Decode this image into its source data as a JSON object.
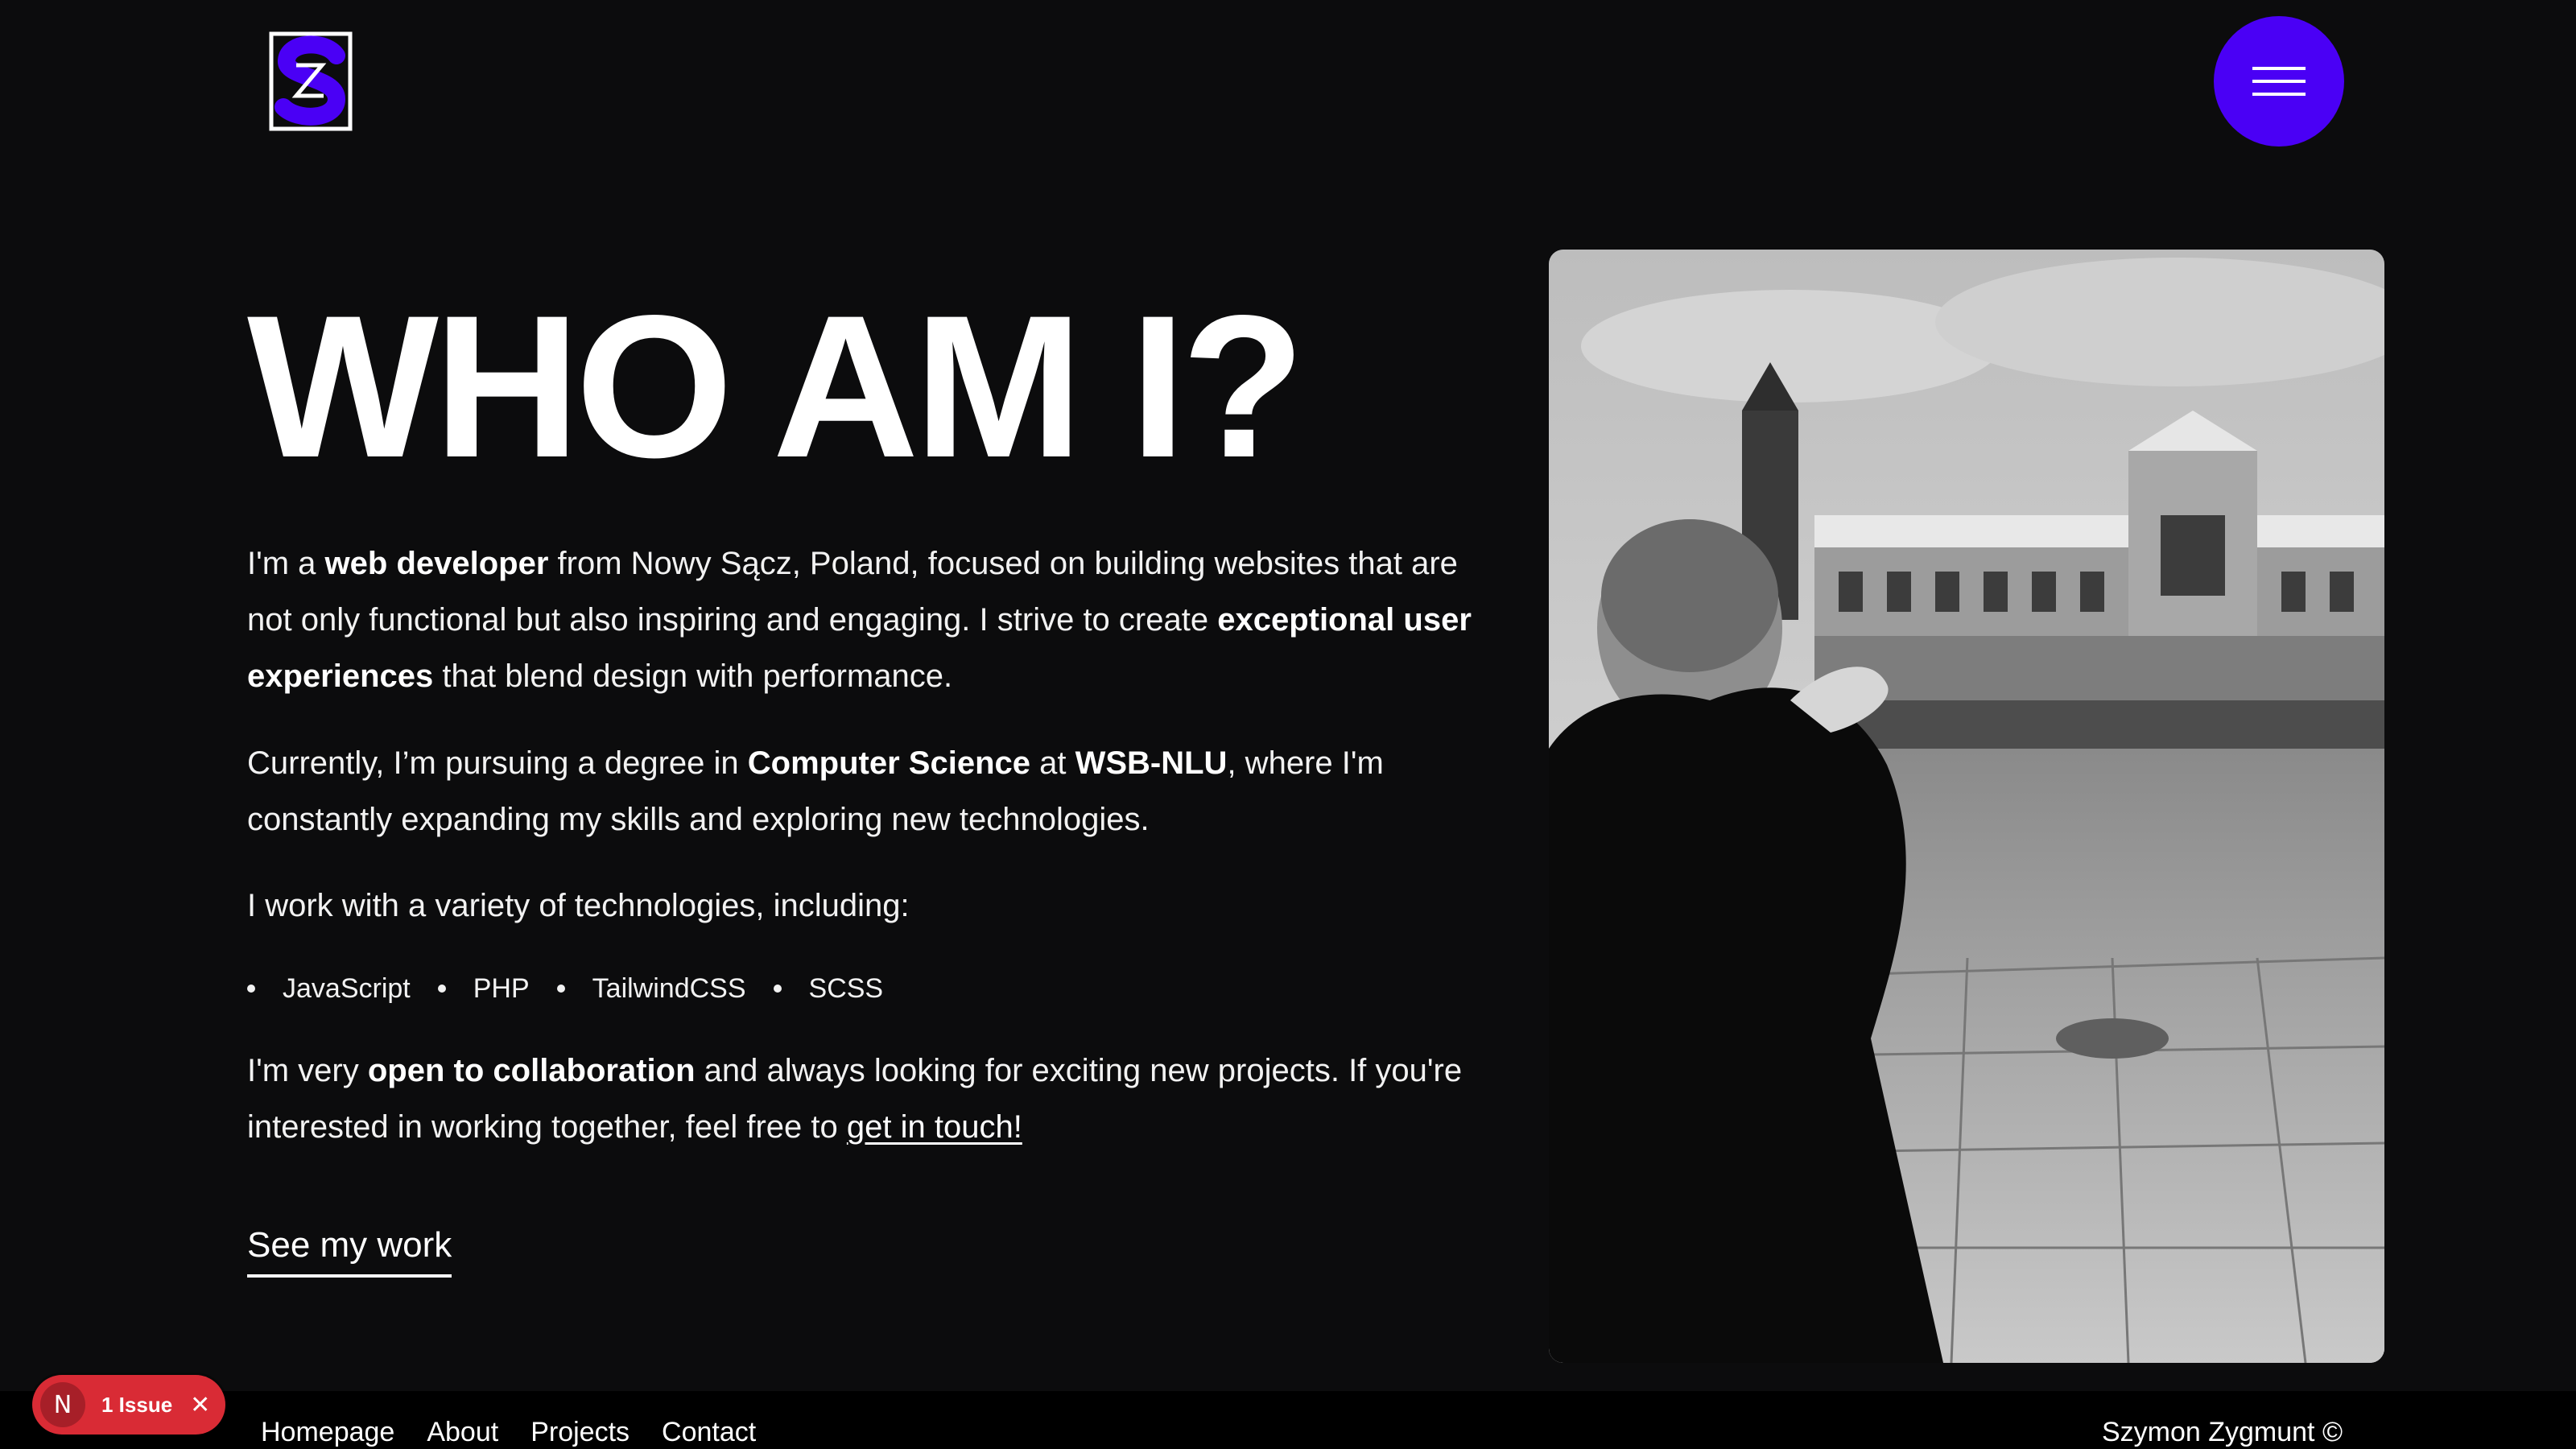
{
  "brand": {
    "logo_icon": "zs-monogram-logo",
    "accent_color": "#4a00f5"
  },
  "header": {
    "menu_icon": "hamburger-menu-icon"
  },
  "hero": {
    "title": "WHO AM I?",
    "intro": {
      "p1": "I'm a ",
      "b1": "web developer",
      "p2": " from Nowy Sącz, Poland, focused on building websites that are not only functional but also inspiring and engaging. I strive to create ",
      "b2": "exceptional user experiences",
      "p3": " that blend design with performance."
    },
    "education": {
      "p1": "Currently, I’m pursuing a degree in ",
      "b1": "Computer Science",
      "p2": " at ",
      "b2": "WSB-NLU",
      "p3": ", where I'm constantly expanding my skills and exploring new technologies."
    },
    "tech_intro": "I work with a variety of technologies, including:",
    "technologies": [
      "JavaScript",
      "PHP",
      "TailwindCSS",
      "SCSS"
    ],
    "collab": {
      "p1": "I'm very ",
      "b1": "open to collaboration",
      "p2": " and always looking for exciting new projects. If you're interested in working together, feel free to ",
      "link": "get in touch!"
    },
    "cta_label": "See my work"
  },
  "photo": {
    "description_icon": "portrait-photo"
  },
  "footer": {
    "nav": [
      "Homepage",
      "About",
      "Projects",
      "Contact"
    ],
    "credit": "Szymon Zygmunt ©"
  },
  "dev_overlay": {
    "avatar_letter": "N",
    "issue_label": "1 Issue",
    "close_glyph": "✕"
  }
}
